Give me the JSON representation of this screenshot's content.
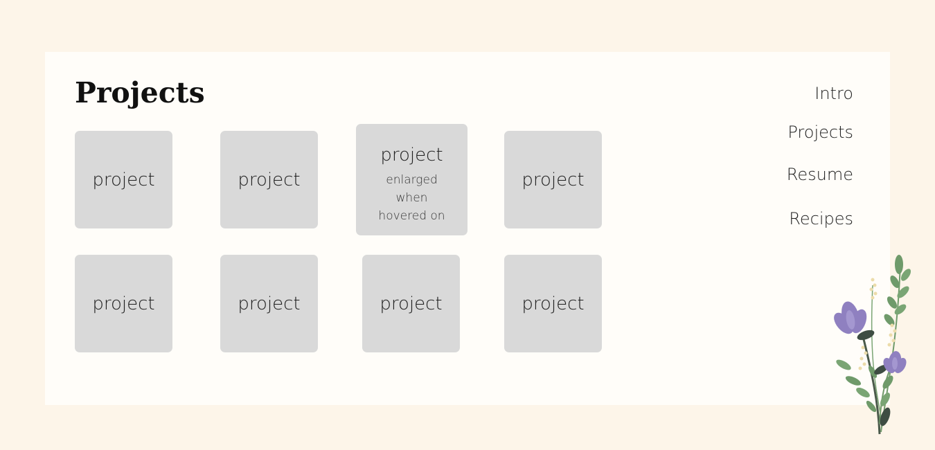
{
  "page": {
    "title": "Projects"
  },
  "projects": [
    {
      "label": "project"
    },
    {
      "label": "project"
    },
    {
      "label": "project",
      "note": "enlarged when hovered on"
    },
    {
      "label": "project"
    },
    {
      "label": "project"
    },
    {
      "label": "project"
    },
    {
      "label": "project"
    },
    {
      "label": "project"
    }
  ],
  "nav": {
    "items": [
      {
        "label": "Intro"
      },
      {
        "label": "Projects"
      },
      {
        "label": "Resume"
      },
      {
        "label": "Recipes"
      }
    ]
  },
  "colors": {
    "background": "#fdf5e9",
    "card": "#fffdf9",
    "tile": "#d9d9d9",
    "flower_petal": "#8f80c0",
    "leaf": "#6f9a6a"
  },
  "icons": {
    "decoration": "flower-bouquet-icon"
  }
}
